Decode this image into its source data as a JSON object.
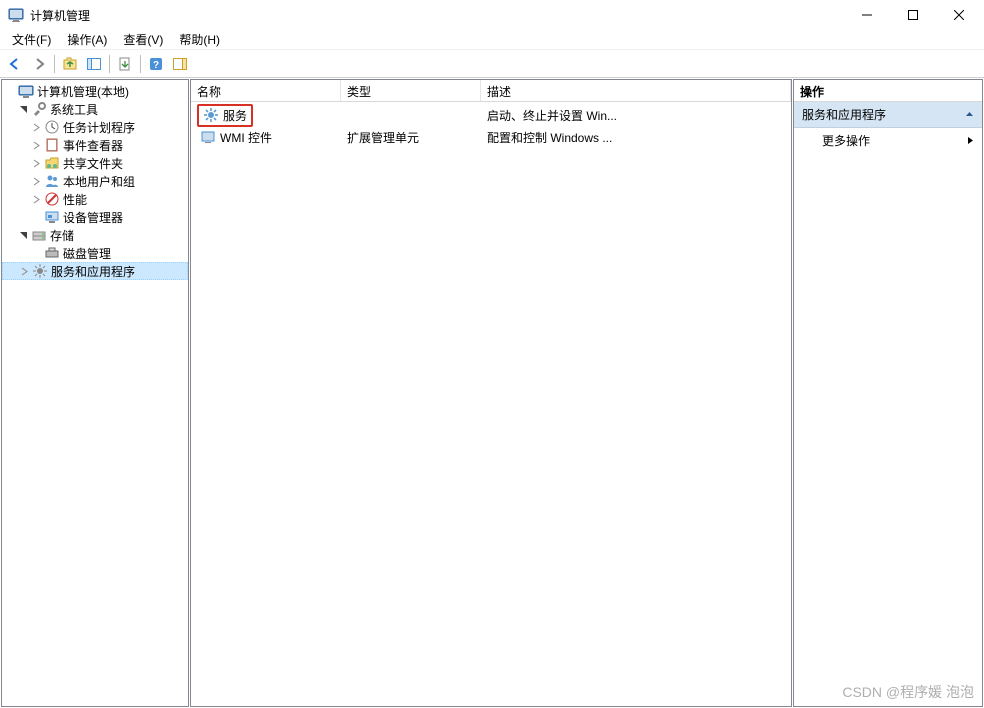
{
  "window": {
    "title": "计算机管理"
  },
  "menus": {
    "file": "文件(F)",
    "action": "操作(A)",
    "view": "查看(V)",
    "help": "帮助(H)"
  },
  "tree": {
    "root": "计算机管理(本地)",
    "system_tools": "系统工具",
    "task_scheduler": "任务计划程序",
    "event_viewer": "事件查看器",
    "shared_folders": "共享文件夹",
    "local_users_groups": "本地用户和组",
    "performance": "性能",
    "device_manager": "设备管理器",
    "storage": "存储",
    "disk_management": "磁盘管理",
    "services_apps": "服务和应用程序"
  },
  "list": {
    "headers": {
      "name": "名称",
      "type": "类型",
      "description": "描述"
    },
    "rows": [
      {
        "name": "服务",
        "type": "",
        "description": "启动、终止并设置 Win..."
      },
      {
        "name": "WMI 控件",
        "type": "扩展管理单元",
        "description": "配置和控制 Windows ..."
      }
    ]
  },
  "actions": {
    "header": "操作",
    "group_title": "服务和应用程序",
    "more_actions": "更多操作"
  },
  "watermark": "CSDN @程序媛 泡泡"
}
